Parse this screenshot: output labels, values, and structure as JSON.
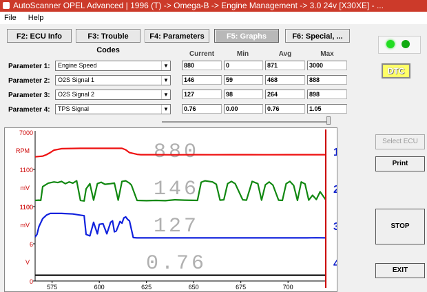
{
  "window": {
    "title": "AutoScanner OPEL Advanced | 1996 (T) -> Omega-B -> Engine Management -> 3.0 24v [X30XE] - ..."
  },
  "menu": {
    "file": "File",
    "help": "Help"
  },
  "tabs": [
    {
      "label": "F2: ECU Info"
    },
    {
      "label": "F3: Trouble Codes"
    },
    {
      "label": "F4: Parameters"
    },
    {
      "label": "F5: Graphs"
    },
    {
      "label": "F6: Special, ..."
    }
  ],
  "columns": {
    "current": "Current",
    "min": "Min",
    "avg": "Avg",
    "max": "Max"
  },
  "parameters": [
    {
      "label": "Parameter 1:",
      "name": "Engine Speed",
      "current": "880",
      "min": "0",
      "avg": "871",
      "max": "3000"
    },
    {
      "label": "Parameter 2:",
      "name": "O2S Signal 1",
      "current": "146",
      "min": "59",
      "avg": "468",
      "max": "888"
    },
    {
      "label": "Parameter 3:",
      "name": "O2S Signal 2",
      "current": "127",
      "min": "98",
      "avg": "264",
      "max": "898"
    },
    {
      "label": "Parameter 4:",
      "name": "TPS Signal",
      "current": "0.76",
      "min": "0.00",
      "avg": "0.76",
      "max": "1.05"
    }
  ],
  "buttons": {
    "select_ecu": "Select ECU",
    "print": "Print",
    "stop": "STOP",
    "exit": "EXIT"
  },
  "dtc": "DTC",
  "colors": {
    "led": "#22cc22",
    "series1": "#ee1111",
    "series2": "#118811",
    "series3": "#1122dd",
    "series4": "#111111",
    "cursor": "#cc0000",
    "axis_label": "#cc0000"
  },
  "chart_data": {
    "type": "line",
    "x_ticks": [
      575,
      600,
      625,
      650,
      675,
      700
    ],
    "xlim": [
      566,
      720
    ],
    "cursor_x": 720,
    "panels": [
      {
        "number": "1",
        "unit": "RPM",
        "y_top_label": "7000",
        "y_bottom_label": "1100",
        "readout": "880",
        "ylim": [
          0,
          4500
        ],
        "x": [
          566,
          570,
          572,
          574,
          576,
          580,
          590,
          600,
          608,
          612,
          614,
          616,
          620,
          622,
          630,
          640,
          650,
          660,
          670,
          680,
          690,
          700,
          710,
          720
        ],
        "values": [
          1400,
          1500,
          1700,
          2000,
          2350,
          2550,
          2600,
          2600,
          2600,
          2600,
          2400,
          2000,
          1750,
          1700,
          1700,
          1680,
          1700,
          1690,
          1700,
          1700,
          1690,
          1700,
          1700,
          1700
        ]
      },
      {
        "number": "2",
        "unit": "mV",
        "y_top_label": "",
        "y_bottom_label": "1100",
        "readout": "146",
        "ylim": [
          0,
          1100
        ],
        "x": [
          566,
          568,
          569,
          570,
          573,
          576,
          578,
          580,
          582,
          584,
          586,
          588,
          590,
          592,
          593,
          595,
          597,
          599,
          601,
          603,
          606,
          608,
          610,
          612,
          614,
          616,
          617,
          620,
          625,
          630,
          635,
          640,
          645,
          652,
          654,
          656,
          660,
          662,
          664,
          666,
          668,
          670,
          672,
          676,
          678,
          681,
          684,
          686,
          688,
          690,
          692,
          695,
          697,
          699,
          701,
          703,
          705,
          707,
          709,
          711,
          713,
          715,
          717,
          720
        ],
        "values": [
          120,
          130,
          120,
          600,
          720,
          760,
          740,
          780,
          700,
          760,
          720,
          800,
          120,
          100,
          520,
          700,
          130,
          700,
          750,
          680,
          700,
          720,
          130,
          780,
          800,
          720,
          650,
          120,
          110,
          120,
          110,
          140,
          130,
          120,
          750,
          800,
          760,
          680,
          130,
          140,
          700,
          780,
          700,
          140,
          130,
          780,
          700,
          130,
          660,
          760,
          650,
          130,
          120,
          700,
          780,
          640,
          120,
          760,
          690,
          130,
          300,
          150,
          420,
          140
        ]
      },
      {
        "number": "3",
        "unit": "mV",
        "y_top_label": "1100",
        "y_bottom_label": "6",
        "readout": "127",
        "ylim": [
          0,
          1100
        ],
        "x": [
          566,
          567,
          568,
          570,
          572,
          574,
          580,
          586,
          590,
          592,
          593,
          595,
          597,
          599,
          600,
          602,
          604,
          606,
          607,
          608,
          609,
          611,
          612,
          613,
          614,
          615,
          616,
          618,
          620,
          630,
          640,
          660,
          680,
          700,
          710,
          715,
          720
        ],
        "values": [
          140,
          230,
          500,
          780,
          900,
          960,
          960,
          940,
          900,
          880,
          230,
          180,
          650,
          250,
          580,
          600,
          250,
          650,
          700,
          320,
          350,
          680,
          620,
          800,
          840,
          750,
          700,
          120,
          110,
          110,
          110,
          110,
          110,
          110,
          110,
          115,
          110
        ]
      },
      {
        "number": "4",
        "unit": "V",
        "y_top_label": "",
        "y_bottom_label": "0",
        "readout": "0.76",
        "ylim": [
          0,
          8
        ],
        "x": [
          566,
          720
        ],
        "values": [
          0.76,
          0.76
        ]
      }
    ]
  }
}
